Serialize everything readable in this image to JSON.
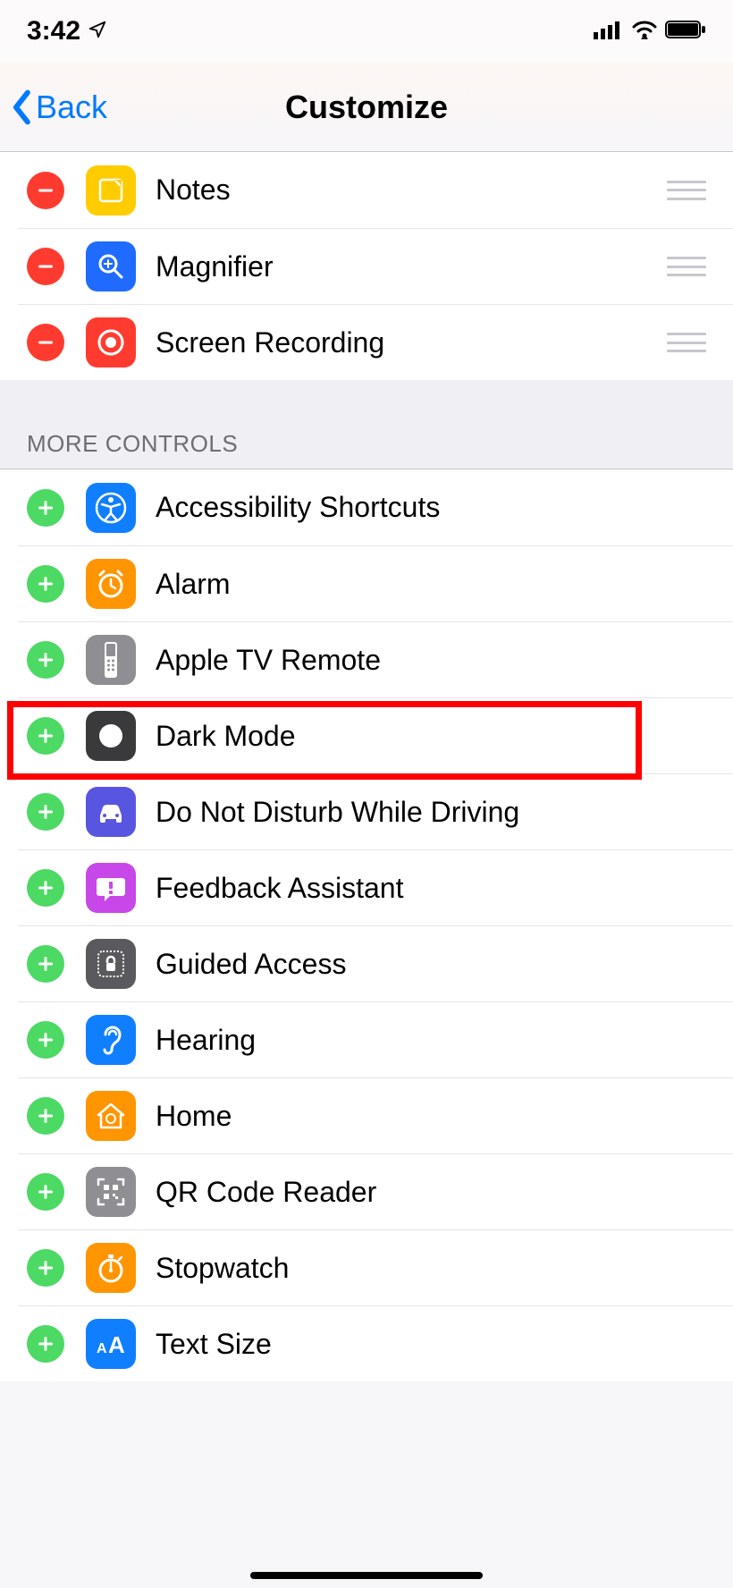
{
  "status": {
    "time": "3:42"
  },
  "nav": {
    "back": "Back",
    "title": "Customize"
  },
  "included": [
    {
      "icon": "notes-icon",
      "label": "Notes"
    },
    {
      "icon": "magnifier-icon",
      "label": "Magnifier"
    },
    {
      "icon": "screen-recording-icon",
      "label": "Screen Recording"
    }
  ],
  "more_header": "MORE CONTROLS",
  "more": [
    {
      "icon": "accessibility-icon",
      "label": "Accessibility Shortcuts"
    },
    {
      "icon": "alarm-icon",
      "label": "Alarm"
    },
    {
      "icon": "apple-tv-remote-icon",
      "label": "Apple TV Remote"
    },
    {
      "icon": "dark-mode-icon",
      "label": "Dark Mode",
      "highlight": true
    },
    {
      "icon": "dnd-driving-icon",
      "label": "Do Not Disturb While Driving"
    },
    {
      "icon": "feedback-assistant-icon",
      "label": "Feedback Assistant"
    },
    {
      "icon": "guided-access-icon",
      "label": "Guided Access"
    },
    {
      "icon": "hearing-icon",
      "label": "Hearing"
    },
    {
      "icon": "home-icon",
      "label": "Home"
    },
    {
      "icon": "qr-code-reader-icon",
      "label": "QR Code Reader"
    },
    {
      "icon": "stopwatch-icon",
      "label": "Stopwatch"
    },
    {
      "icon": "text-size-icon",
      "label": "Text Size"
    }
  ]
}
